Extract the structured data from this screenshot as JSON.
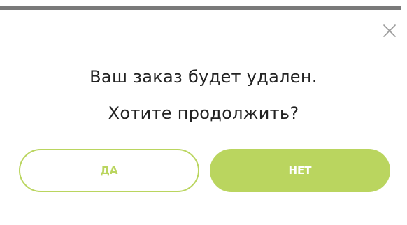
{
  "dialog": {
    "message_line1": "Ваш заказ будет удален.",
    "message_line2": "Хотите продолжить?",
    "close_icon": "close-icon",
    "buttons": {
      "yes_label": "ДА",
      "no_label": "НЕТ"
    }
  },
  "colors": {
    "accent": "#bad55f",
    "top_bar": "#7a7a7a",
    "text": "#222222",
    "close_icon": "#9a9a9a"
  }
}
